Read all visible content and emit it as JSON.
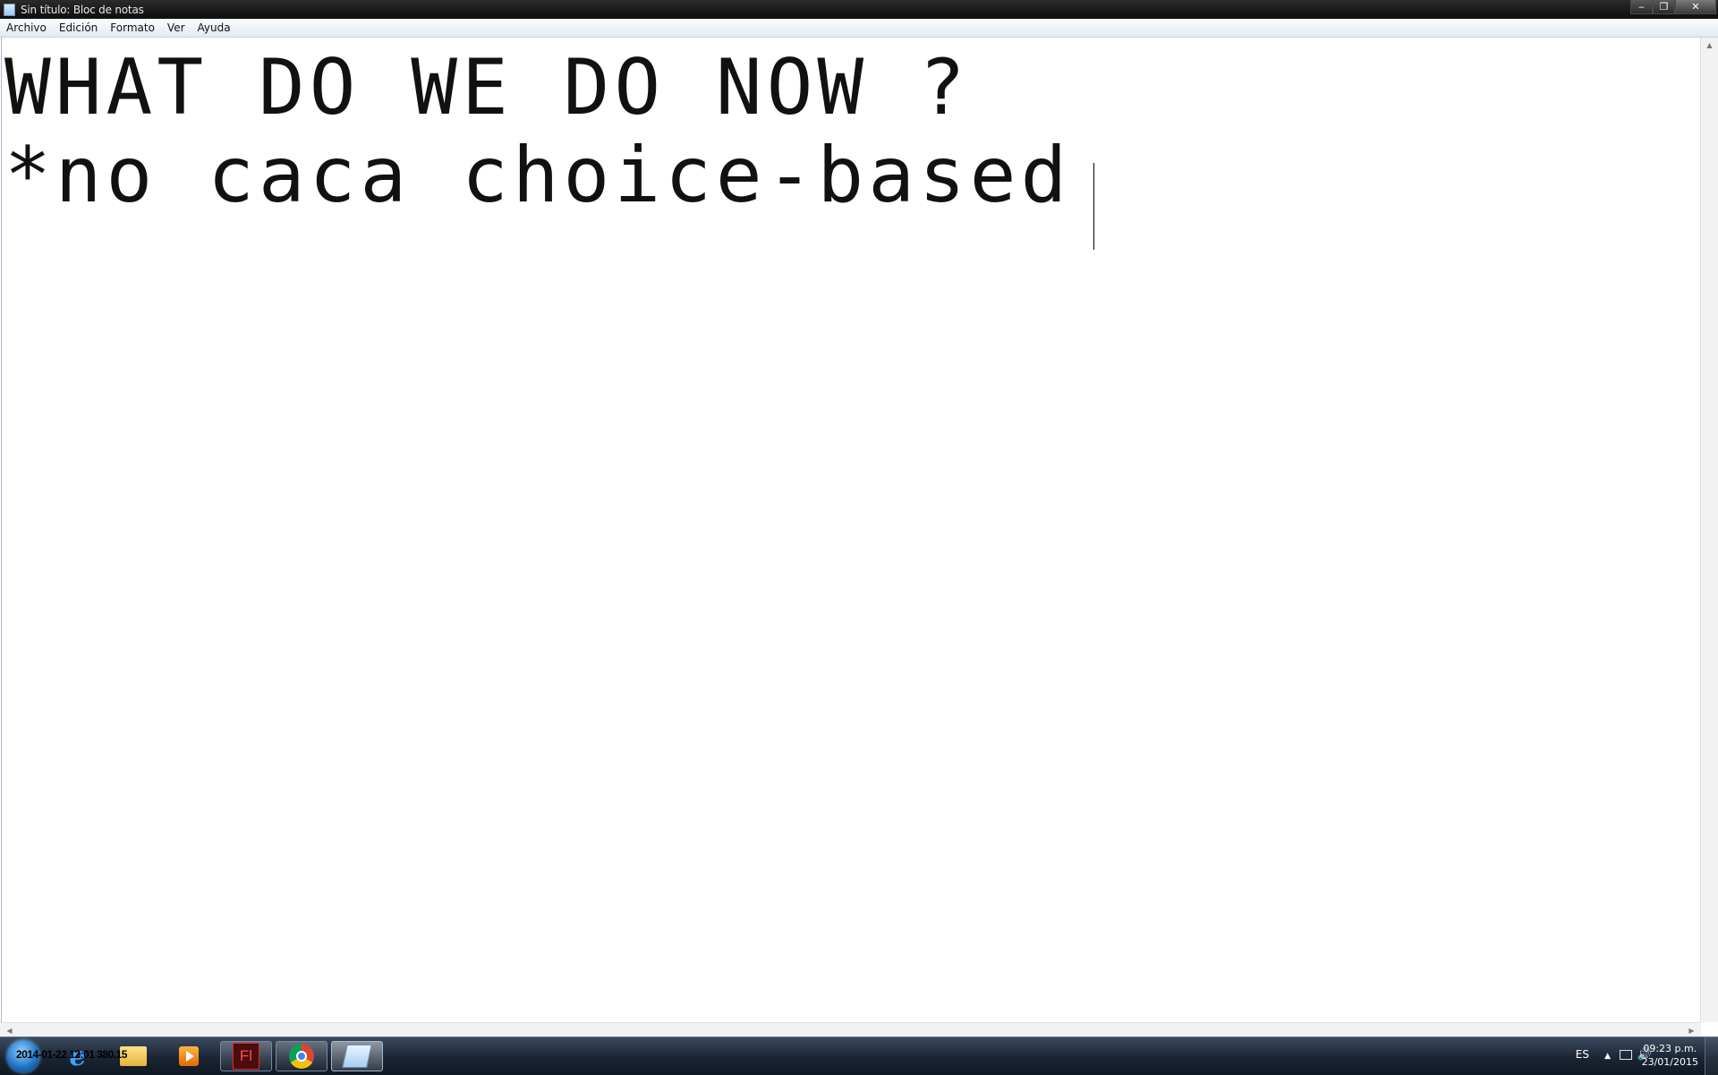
{
  "window": {
    "title": "Sin título: Bloc de notas",
    "controls": {
      "minimize": "‒",
      "maximize": "❐",
      "close": "✕"
    }
  },
  "menu": {
    "items": [
      "Archivo",
      "Edición",
      "Formato",
      "Ver",
      "Ayuda"
    ]
  },
  "editor": {
    "lines": [
      "WHAT DO WE DO NOW ?",
      "*no caca choice-based"
    ]
  },
  "taskbar": {
    "overlay_text": "2014-01-22 12:01 380.15",
    "apps": [
      {
        "name": "internet-explorer",
        "glyph": "e"
      },
      {
        "name": "file-explorer"
      },
      {
        "name": "media-player"
      },
      {
        "name": "flash",
        "glyph": "Fl"
      },
      {
        "name": "chrome"
      },
      {
        "name": "notepad"
      }
    ],
    "tray": {
      "language": "ES",
      "time": "09:23 p.m.",
      "date": "23/01/2015"
    }
  }
}
